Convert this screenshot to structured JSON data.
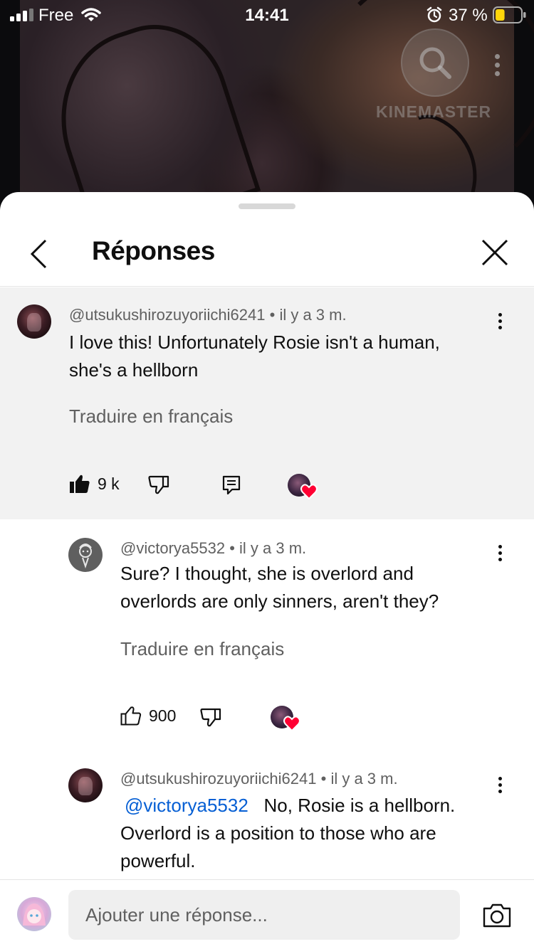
{
  "status_bar": {
    "carrier": "Free",
    "time": "14:41",
    "battery_percent": "37 %",
    "battery_level": 0.37,
    "icons": [
      "signal-icon",
      "wifi-icon",
      "alarm-icon",
      "battery-icon"
    ]
  },
  "video": {
    "watermark": "KINEMASTER",
    "icons": [
      "search-icon",
      "more-vertical-icon"
    ]
  },
  "sheet": {
    "title": "Réponses",
    "icons": [
      "back-chevron-icon",
      "close-icon"
    ]
  },
  "comments": [
    {
      "author": "@utsukushirozuyoriichi6241",
      "time": "il y a 3 m.",
      "text_lines": [
        "I love this! Unfortunately Rosie isn't a human,",
        "she's a hellborn"
      ],
      "translate_label": "Traduire en français",
      "likes": "9 k",
      "liked": true
    },
    {
      "author": "@victorya5532",
      "time": "il y a 3 m.",
      "text_lines": [
        "Sure? I thought, she is overlord and",
        "overlords are only sinners, aren't they?"
      ],
      "translate_label": "Traduire en français",
      "likes": "900",
      "liked": false
    },
    {
      "author": "@utsukushirozuyoriichi6241",
      "time": "il y a 3 m.",
      "mention": "@victorya5532",
      "text_first": "No, Rosie is a hellborn.",
      "text_lines": [
        "Overlord is a position to those who are",
        "powerful."
      ]
    }
  ],
  "composer": {
    "placeholder": "Ajouter une réponse...",
    "icons": [
      "camera-icon"
    ]
  },
  "colors": {
    "heart": "#ff0033",
    "mention": "#065fd4",
    "highlight_bg": "#f2f2f2"
  }
}
